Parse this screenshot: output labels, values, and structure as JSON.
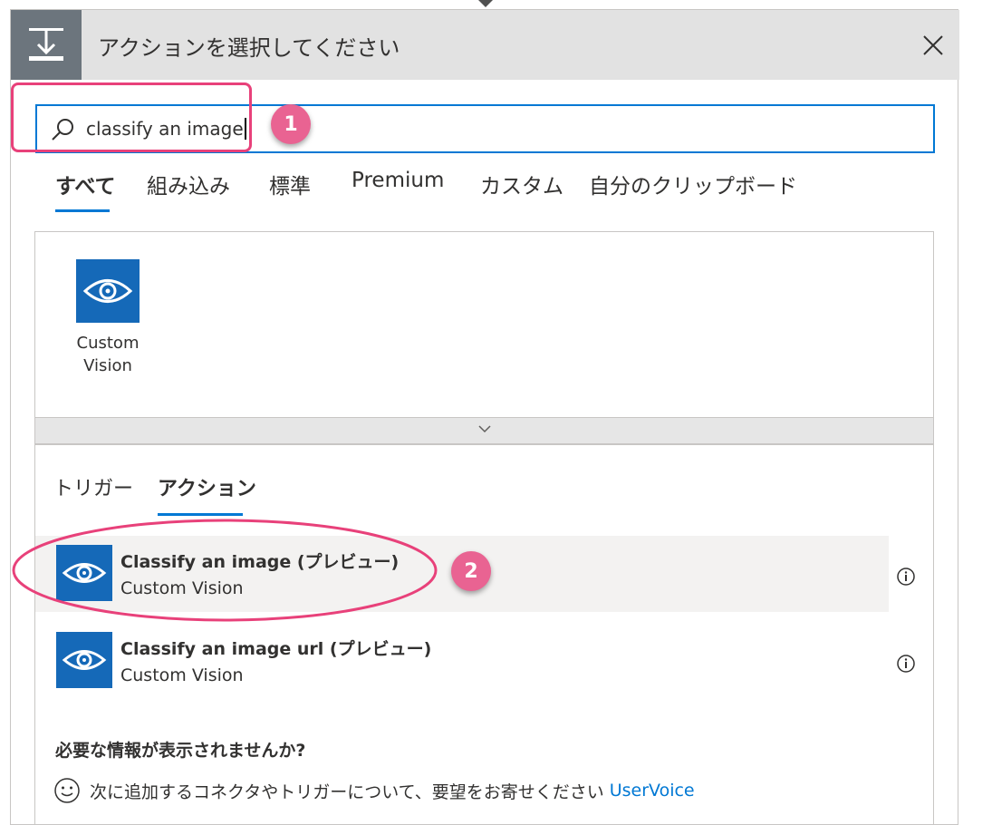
{
  "header": {
    "title": "アクションを選択してください",
    "icon": "action-step-icon",
    "close_icon": "close-icon",
    "background_color": "#e2e2e2",
    "icon_box_color": "#6c757d"
  },
  "search": {
    "value": "classify an image",
    "icon": "search-icon",
    "border_color": "#0078d4"
  },
  "annotations": {
    "badge1": "1",
    "badge2": "2",
    "color": "#e8417a"
  },
  "tabs": [
    {
      "label": "すべて",
      "active": true
    },
    {
      "label": "組み込み",
      "active": false
    },
    {
      "label": "標準",
      "active": false
    },
    {
      "label": "Premium",
      "active": false
    },
    {
      "label": "カスタム",
      "active": false
    },
    {
      "label": "自分のクリップボード",
      "active": false
    }
  ],
  "connectors": [
    {
      "name_line1": "Custom",
      "name_line2": "Vision",
      "icon": "eye-gear-icon",
      "color": "#1569b8"
    }
  ],
  "expander_icon": "chevron-down-icon",
  "subtabs": [
    {
      "label": "トリガー",
      "active": false
    },
    {
      "label": "アクション",
      "active": true
    }
  ],
  "results": [
    {
      "title": "Classify an image (プレビュー)",
      "connector": "Custom Vision",
      "icon": "eye-gear-icon",
      "info_icon": "info-icon"
    },
    {
      "title": "Classify an image url (プレビュー)",
      "connector": "Custom Vision",
      "icon": "eye-gear-icon",
      "info_icon": "info-icon"
    }
  ],
  "feedback": {
    "title": "必要な情報が表示されませんか?",
    "text": "次に追加するコネクタやトリガーについて、要望をお寄せください",
    "link": "UserVoice",
    "icon": "smiley-icon",
    "link_color": "#0078d4"
  }
}
